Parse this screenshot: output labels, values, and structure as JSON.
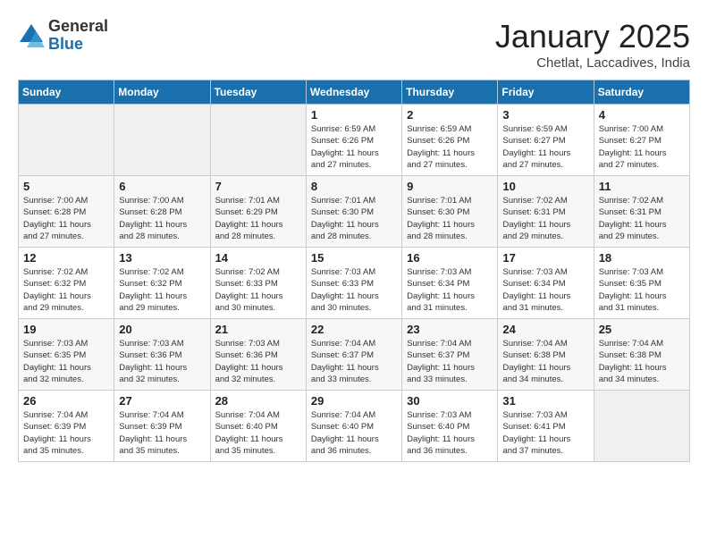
{
  "logo": {
    "general": "General",
    "blue": "Blue"
  },
  "title": "January 2025",
  "subtitle": "Chetlat, Laccadives, India",
  "days_of_week": [
    "Sunday",
    "Monday",
    "Tuesday",
    "Wednesday",
    "Thursday",
    "Friday",
    "Saturday"
  ],
  "weeks": [
    [
      {
        "day": "",
        "info": ""
      },
      {
        "day": "",
        "info": ""
      },
      {
        "day": "",
        "info": ""
      },
      {
        "day": "1",
        "info": "Sunrise: 6:59 AM\nSunset: 6:26 PM\nDaylight: 11 hours\nand 27 minutes."
      },
      {
        "day": "2",
        "info": "Sunrise: 6:59 AM\nSunset: 6:26 PM\nDaylight: 11 hours\nand 27 minutes."
      },
      {
        "day": "3",
        "info": "Sunrise: 6:59 AM\nSunset: 6:27 PM\nDaylight: 11 hours\nand 27 minutes."
      },
      {
        "day": "4",
        "info": "Sunrise: 7:00 AM\nSunset: 6:27 PM\nDaylight: 11 hours\nand 27 minutes."
      }
    ],
    [
      {
        "day": "5",
        "info": "Sunrise: 7:00 AM\nSunset: 6:28 PM\nDaylight: 11 hours\nand 27 minutes."
      },
      {
        "day": "6",
        "info": "Sunrise: 7:00 AM\nSunset: 6:28 PM\nDaylight: 11 hours\nand 28 minutes."
      },
      {
        "day": "7",
        "info": "Sunrise: 7:01 AM\nSunset: 6:29 PM\nDaylight: 11 hours\nand 28 minutes."
      },
      {
        "day": "8",
        "info": "Sunrise: 7:01 AM\nSunset: 6:30 PM\nDaylight: 11 hours\nand 28 minutes."
      },
      {
        "day": "9",
        "info": "Sunrise: 7:01 AM\nSunset: 6:30 PM\nDaylight: 11 hours\nand 28 minutes."
      },
      {
        "day": "10",
        "info": "Sunrise: 7:02 AM\nSunset: 6:31 PM\nDaylight: 11 hours\nand 29 minutes."
      },
      {
        "day": "11",
        "info": "Sunrise: 7:02 AM\nSunset: 6:31 PM\nDaylight: 11 hours\nand 29 minutes."
      }
    ],
    [
      {
        "day": "12",
        "info": "Sunrise: 7:02 AM\nSunset: 6:32 PM\nDaylight: 11 hours\nand 29 minutes."
      },
      {
        "day": "13",
        "info": "Sunrise: 7:02 AM\nSunset: 6:32 PM\nDaylight: 11 hours\nand 29 minutes."
      },
      {
        "day": "14",
        "info": "Sunrise: 7:02 AM\nSunset: 6:33 PM\nDaylight: 11 hours\nand 30 minutes."
      },
      {
        "day": "15",
        "info": "Sunrise: 7:03 AM\nSunset: 6:33 PM\nDaylight: 11 hours\nand 30 minutes."
      },
      {
        "day": "16",
        "info": "Sunrise: 7:03 AM\nSunset: 6:34 PM\nDaylight: 11 hours\nand 31 minutes."
      },
      {
        "day": "17",
        "info": "Sunrise: 7:03 AM\nSunset: 6:34 PM\nDaylight: 11 hours\nand 31 minutes."
      },
      {
        "day": "18",
        "info": "Sunrise: 7:03 AM\nSunset: 6:35 PM\nDaylight: 11 hours\nand 31 minutes."
      }
    ],
    [
      {
        "day": "19",
        "info": "Sunrise: 7:03 AM\nSunset: 6:35 PM\nDaylight: 11 hours\nand 32 minutes."
      },
      {
        "day": "20",
        "info": "Sunrise: 7:03 AM\nSunset: 6:36 PM\nDaylight: 11 hours\nand 32 minutes."
      },
      {
        "day": "21",
        "info": "Sunrise: 7:03 AM\nSunset: 6:36 PM\nDaylight: 11 hours\nand 32 minutes."
      },
      {
        "day": "22",
        "info": "Sunrise: 7:04 AM\nSunset: 6:37 PM\nDaylight: 11 hours\nand 33 minutes."
      },
      {
        "day": "23",
        "info": "Sunrise: 7:04 AM\nSunset: 6:37 PM\nDaylight: 11 hours\nand 33 minutes."
      },
      {
        "day": "24",
        "info": "Sunrise: 7:04 AM\nSunset: 6:38 PM\nDaylight: 11 hours\nand 34 minutes."
      },
      {
        "day": "25",
        "info": "Sunrise: 7:04 AM\nSunset: 6:38 PM\nDaylight: 11 hours\nand 34 minutes."
      }
    ],
    [
      {
        "day": "26",
        "info": "Sunrise: 7:04 AM\nSunset: 6:39 PM\nDaylight: 11 hours\nand 35 minutes."
      },
      {
        "day": "27",
        "info": "Sunrise: 7:04 AM\nSunset: 6:39 PM\nDaylight: 11 hours\nand 35 minutes."
      },
      {
        "day": "28",
        "info": "Sunrise: 7:04 AM\nSunset: 6:40 PM\nDaylight: 11 hours\nand 35 minutes."
      },
      {
        "day": "29",
        "info": "Sunrise: 7:04 AM\nSunset: 6:40 PM\nDaylight: 11 hours\nand 36 minutes."
      },
      {
        "day": "30",
        "info": "Sunrise: 7:03 AM\nSunset: 6:40 PM\nDaylight: 11 hours\nand 36 minutes."
      },
      {
        "day": "31",
        "info": "Sunrise: 7:03 AM\nSunset: 6:41 PM\nDaylight: 11 hours\nand 37 minutes."
      },
      {
        "day": "",
        "info": ""
      }
    ]
  ]
}
